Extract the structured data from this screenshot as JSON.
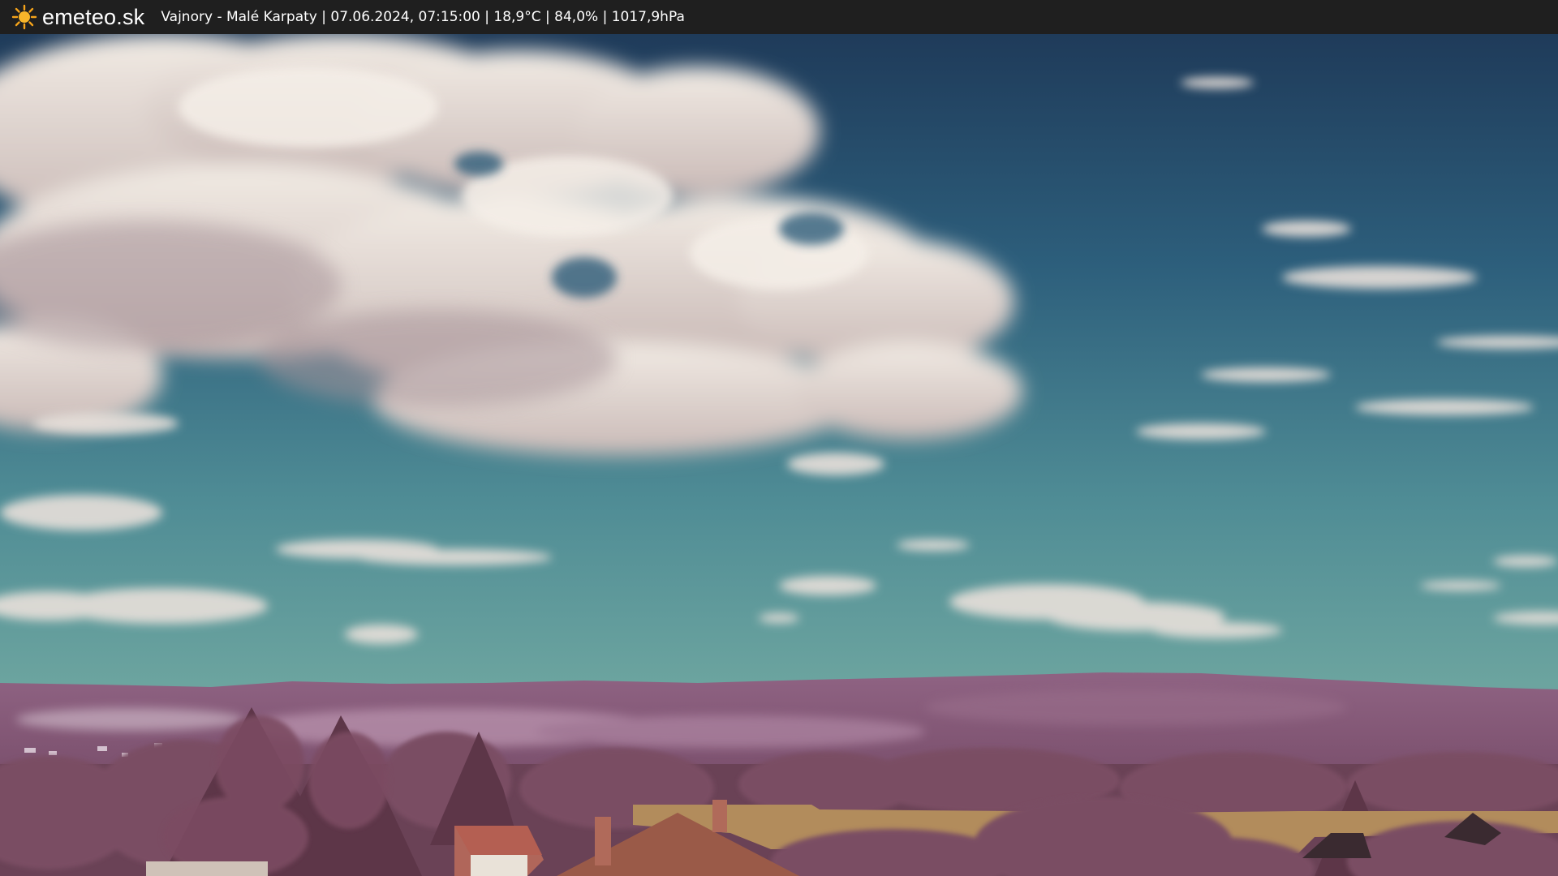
{
  "header": {
    "brand": "emeteo.sk",
    "logo_icon": "sun-icon",
    "caption": "Vajnory - Malé Karpaty | 07.06.2024, 07:15:00 | 18,9°C | 84,0% | 1017,9hPa"
  },
  "colors": {
    "bar_background": "#1f1f1f",
    "sun": "#f5a31a",
    "sky_top": "#1f3f5e",
    "sky_bottom": "#5f9a9c",
    "cloud": "#ece4dc",
    "hills": "#8a5a78",
    "foliage": "#6e4458",
    "field": "#b08a5a"
  }
}
